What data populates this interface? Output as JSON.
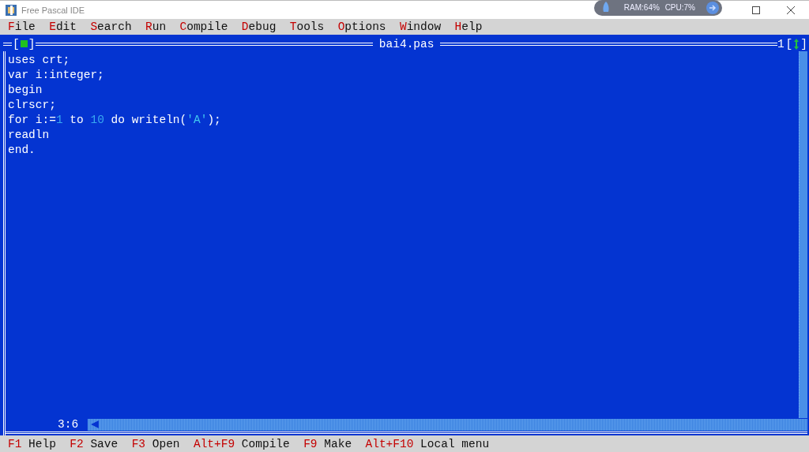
{
  "window": {
    "title": "Free Pascal IDE"
  },
  "monitor_widget": {
    "text": "RAM:64% CPU:7%"
  },
  "menu": [
    {
      "label": "File"
    },
    {
      "label": "Edit"
    },
    {
      "label": "Search"
    },
    {
      "label": "Run"
    },
    {
      "label": "Compile"
    },
    {
      "label": "Debug"
    },
    {
      "label": "Tools"
    },
    {
      "label": "Options"
    },
    {
      "label": "Window"
    },
    {
      "label": "Help"
    }
  ],
  "editor": {
    "close_box_brackets": [
      "[",
      "]"
    ],
    "zoom_box_brackets": [
      "[",
      "]"
    ],
    "title": "bai4.pas",
    "window_number": "1",
    "cursor_position": "3:6",
    "lines": [
      [
        {
          "kind": "plain",
          "text": "uses crt;"
        }
      ],
      [
        {
          "kind": "plain",
          "text": "var i:integer;"
        }
      ],
      [
        {
          "kind": "plain",
          "text": "begin"
        }
      ],
      [
        {
          "kind": "plain",
          "text": "clrscr;"
        }
      ],
      [
        {
          "kind": "plain",
          "text": "for i:="
        },
        {
          "kind": "number",
          "text": "1"
        },
        {
          "kind": "plain",
          "text": " to "
        },
        {
          "kind": "number",
          "text": "10"
        },
        {
          "kind": "plain",
          "text": " do writeln("
        },
        {
          "kind": "string",
          "text": "'A'"
        },
        {
          "kind": "plain",
          "text": ");"
        }
      ],
      [
        {
          "kind": "plain",
          "text": "readln"
        }
      ],
      [
        {
          "kind": "plain",
          "text": "end."
        }
      ]
    ]
  },
  "status_bar": [
    {
      "key": "F1",
      "label": "Help"
    },
    {
      "key": "F2",
      "label": "Save"
    },
    {
      "key": "F3",
      "label": "Open"
    },
    {
      "key": "Alt+F9",
      "label": "Compile"
    },
    {
      "key": "F9",
      "label": "Make"
    },
    {
      "key": "Alt+F10",
      "label": "Local menu"
    }
  ]
}
